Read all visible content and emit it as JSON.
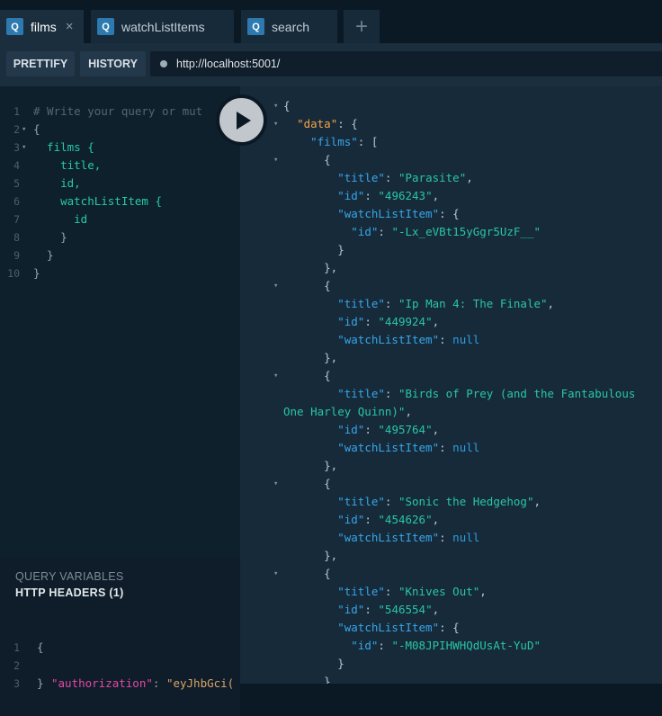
{
  "tabs": [
    {
      "label": "films",
      "badge": "Q",
      "active": true
    },
    {
      "label": "watchListItems",
      "badge": "Q",
      "active": false
    },
    {
      "label": "search",
      "badge": "Q",
      "active": false
    }
  ],
  "tab_close": "×",
  "add_tab": "+",
  "toolbar": {
    "prettify": "PRETTIFY",
    "history": "HISTORY",
    "url": "http://localhost:5001/"
  },
  "query": [
    {
      "n": "1",
      "fold": false,
      "text": "# Write your query or mut",
      "kind": "comment"
    },
    {
      "n": "2",
      "fold": true,
      "text": "{",
      "kind": "punct"
    },
    {
      "n": "3",
      "fold": true,
      "text": "  films {",
      "kind": "field"
    },
    {
      "n": "4",
      "fold": false,
      "text": "    title,",
      "kind": "field"
    },
    {
      "n": "5",
      "fold": false,
      "text": "    id,",
      "kind": "field"
    },
    {
      "n": "6",
      "fold": false,
      "text": "    watchListItem {",
      "kind": "field"
    },
    {
      "n": "7",
      "fold": false,
      "text": "      id",
      "kind": "field"
    },
    {
      "n": "8",
      "fold": false,
      "text": "    }",
      "kind": "punct"
    },
    {
      "n": "9",
      "fold": false,
      "text": "  }",
      "kind": "punct"
    },
    {
      "n": "10",
      "fold": false,
      "text": "}",
      "kind": "punct"
    }
  ],
  "panel": {
    "query_variables": "QUERY VARIABLES",
    "http_headers": "HTTP HEADERS (1)"
  },
  "headers": {
    "line1": "{",
    "key": "\"authorization\"",
    "colon": ": ",
    "value": "\"eyJhbGci(",
    "line3": "}"
  },
  "result": [
    {
      "fold": true,
      "parts": [
        [
          "p",
          "{"
        ]
      ]
    },
    {
      "fold": true,
      "parts": [
        [
          "p",
          "  "
        ],
        [
          "d",
          "\"data\""
        ],
        [
          "p",
          ": {"
        ]
      ]
    },
    {
      "fold": false,
      "parts": [
        [
          "p",
          "    "
        ],
        [
          "k",
          "\"films\""
        ],
        [
          "p",
          ": ["
        ]
      ]
    },
    {
      "fold": true,
      "parts": [
        [
          "p",
          "      {"
        ]
      ]
    },
    {
      "fold": false,
      "parts": [
        [
          "p",
          "        "
        ],
        [
          "k",
          "\"title\""
        ],
        [
          "p",
          ": "
        ],
        [
          "s",
          "\"Parasite\""
        ],
        [
          "p",
          ","
        ]
      ]
    },
    {
      "fold": false,
      "parts": [
        [
          "p",
          "        "
        ],
        [
          "k",
          "\"id\""
        ],
        [
          "p",
          ": "
        ],
        [
          "s",
          "\"496243\""
        ],
        [
          "p",
          ","
        ]
      ]
    },
    {
      "fold": false,
      "parts": [
        [
          "p",
          "        "
        ],
        [
          "k",
          "\"watchListItem\""
        ],
        [
          "p",
          ": {"
        ]
      ]
    },
    {
      "fold": false,
      "parts": [
        [
          "p",
          "          "
        ],
        [
          "k",
          "\"id\""
        ],
        [
          "p",
          ": "
        ],
        [
          "s",
          "\"-Lx_eVBt15yGgr5UzF__\""
        ]
      ]
    },
    {
      "fold": false,
      "parts": [
        [
          "p",
          "        }"
        ]
      ]
    },
    {
      "fold": false,
      "parts": [
        [
          "p",
          "      },"
        ]
      ]
    },
    {
      "fold": true,
      "parts": [
        [
          "p",
          "      {"
        ]
      ]
    },
    {
      "fold": false,
      "parts": [
        [
          "p",
          "        "
        ],
        [
          "k",
          "\"title\""
        ],
        [
          "p",
          ": "
        ],
        [
          "s",
          "\"Ip Man 4: The Finale\""
        ],
        [
          "p",
          ","
        ]
      ]
    },
    {
      "fold": false,
      "parts": [
        [
          "p",
          "        "
        ],
        [
          "k",
          "\"id\""
        ],
        [
          "p",
          ": "
        ],
        [
          "s",
          "\"449924\""
        ],
        [
          "p",
          ","
        ]
      ]
    },
    {
      "fold": false,
      "parts": [
        [
          "p",
          "        "
        ],
        [
          "k",
          "\"watchListItem\""
        ],
        [
          "p",
          ": "
        ],
        [
          "n",
          "null"
        ]
      ]
    },
    {
      "fold": false,
      "parts": [
        [
          "p",
          "      },"
        ]
      ]
    },
    {
      "fold": true,
      "parts": [
        [
          "p",
          "      {"
        ]
      ]
    },
    {
      "fold": false,
      "parts": [
        [
          "p",
          "        "
        ],
        [
          "k",
          "\"title\""
        ],
        [
          "p",
          ": "
        ],
        [
          "s",
          "\"Birds of Prey (and the Fantabulous"
        ]
      ]
    },
    {
      "fold": false,
      "parts": [
        [
          "s",
          "One Harley Quinn)\""
        ],
        [
          "p",
          ","
        ]
      ]
    },
    {
      "fold": false,
      "parts": [
        [
          "p",
          "        "
        ],
        [
          "k",
          "\"id\""
        ],
        [
          "p",
          ": "
        ],
        [
          "s",
          "\"495764\""
        ],
        [
          "p",
          ","
        ]
      ]
    },
    {
      "fold": false,
      "parts": [
        [
          "p",
          "        "
        ],
        [
          "k",
          "\"watchListItem\""
        ],
        [
          "p",
          ": "
        ],
        [
          "n",
          "null"
        ]
      ]
    },
    {
      "fold": false,
      "parts": [
        [
          "p",
          "      },"
        ]
      ]
    },
    {
      "fold": true,
      "parts": [
        [
          "p",
          "      {"
        ]
      ]
    },
    {
      "fold": false,
      "parts": [
        [
          "p",
          "        "
        ],
        [
          "k",
          "\"title\""
        ],
        [
          "p",
          ": "
        ],
        [
          "s",
          "\"Sonic the Hedgehog\""
        ],
        [
          "p",
          ","
        ]
      ]
    },
    {
      "fold": false,
      "parts": [
        [
          "p",
          "        "
        ],
        [
          "k",
          "\"id\""
        ],
        [
          "p",
          ": "
        ],
        [
          "s",
          "\"454626\""
        ],
        [
          "p",
          ","
        ]
      ]
    },
    {
      "fold": false,
      "parts": [
        [
          "p",
          "        "
        ],
        [
          "k",
          "\"watchListItem\""
        ],
        [
          "p",
          ": "
        ],
        [
          "n",
          "null"
        ]
      ]
    },
    {
      "fold": false,
      "parts": [
        [
          "p",
          "      },"
        ]
      ]
    },
    {
      "fold": true,
      "parts": [
        [
          "p",
          "      {"
        ]
      ]
    },
    {
      "fold": false,
      "parts": [
        [
          "p",
          "        "
        ],
        [
          "k",
          "\"title\""
        ],
        [
          "p",
          ": "
        ],
        [
          "s",
          "\"Knives Out\""
        ],
        [
          "p",
          ","
        ]
      ]
    },
    {
      "fold": false,
      "parts": [
        [
          "p",
          "        "
        ],
        [
          "k",
          "\"id\""
        ],
        [
          "p",
          ": "
        ],
        [
          "s",
          "\"546554\""
        ],
        [
          "p",
          ","
        ]
      ]
    },
    {
      "fold": false,
      "parts": [
        [
          "p",
          "        "
        ],
        [
          "k",
          "\"watchListItem\""
        ],
        [
          "p",
          ": {"
        ]
      ]
    },
    {
      "fold": false,
      "parts": [
        [
          "p",
          "          "
        ],
        [
          "k",
          "\"id\""
        ],
        [
          "p",
          ": "
        ],
        [
          "s",
          "\"-M08JPIHWHQdUsAt-YuD\""
        ]
      ]
    },
    {
      "fold": false,
      "parts": [
        [
          "p",
          "        }"
        ]
      ]
    },
    {
      "fold": false,
      "parts": [
        [
          "p",
          "      }"
        ]
      ]
    }
  ],
  "icons": {
    "tab_badge": "query-badge-icon",
    "run": "play-icon",
    "fold": "chevron-down-icon",
    "status": "status-dot-icon"
  },
  "colors": {
    "string": "#29c5ab",
    "key": "#36a6e8",
    "data": "#f4a44a",
    "header_key": "#e548a7",
    "badge": "#2c7ab0"
  }
}
